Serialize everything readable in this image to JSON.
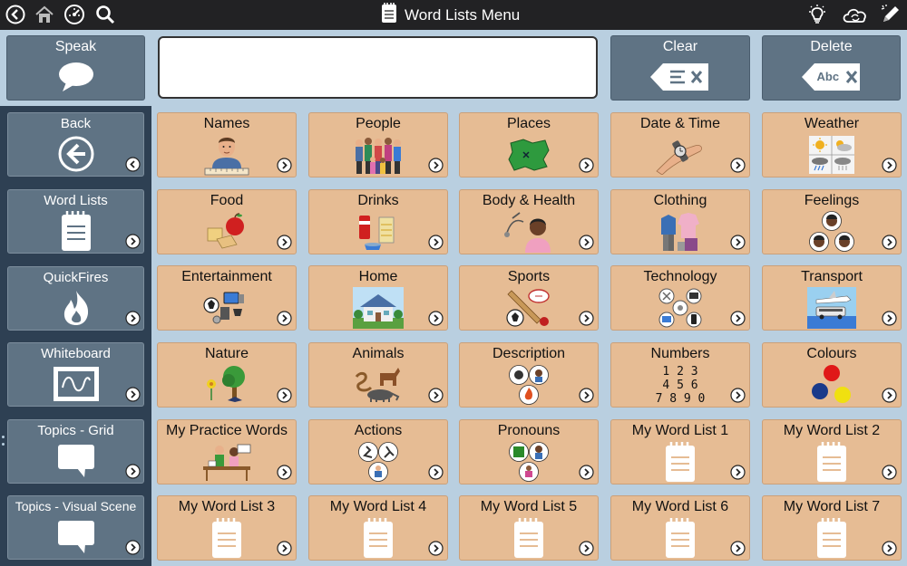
{
  "topbar": {
    "title": "Word Lists Menu",
    "left_icons": [
      "back-circle-icon",
      "home-icon",
      "dashboard-icon",
      "search-icon"
    ],
    "right_icons": [
      "lightbulb-icon",
      "cloud-sync-icon",
      "edit-pencil-icon"
    ]
  },
  "speak_row": {
    "speak_label": "Speak",
    "message_text": "",
    "clear_label": "Clear",
    "delete_label": "Delete",
    "delete_icon_text": "Abc"
  },
  "sidebar": {
    "items": [
      {
        "label": "Back",
        "icon": "back-arrow-icon"
      },
      {
        "label": "Word Lists",
        "icon": "notepad-icon"
      },
      {
        "label": "QuickFires",
        "icon": "flame-icon"
      },
      {
        "label": "Whiteboard",
        "icon": "whiteboard-icon"
      },
      {
        "label": "Topics - Grid",
        "icon": "speech-bubble-icon"
      },
      {
        "label": "Topics - Visual Scene",
        "icon": "speech-bubble-icon"
      }
    ]
  },
  "grid": {
    "tiles": [
      {
        "label": "Names",
        "icon": "person-portrait-icon"
      },
      {
        "label": "People",
        "icon": "people-group-icon"
      },
      {
        "label": "Places",
        "icon": "map-icon"
      },
      {
        "label": "Date & Time",
        "icon": "wristwatch-icon"
      },
      {
        "label": "Weather",
        "icon": "weather-icon"
      },
      {
        "label": "Food",
        "icon": "food-icon"
      },
      {
        "label": "Drinks",
        "icon": "drinks-icon"
      },
      {
        "label": "Body & Health",
        "icon": "doctor-icon"
      },
      {
        "label": "Clothing",
        "icon": "clothes-icon"
      },
      {
        "label": "Feelings",
        "icon": "faces-icon"
      },
      {
        "label": "Entertainment",
        "icon": "entertainment-icon"
      },
      {
        "label": "Home",
        "icon": "house-icon"
      },
      {
        "label": "Sports",
        "icon": "sports-balls-icon"
      },
      {
        "label": "Technology",
        "icon": "devices-icon"
      },
      {
        "label": "Transport",
        "icon": "transport-icon"
      },
      {
        "label": "Nature",
        "icon": "tree-icon"
      },
      {
        "label": "Animals",
        "icon": "animals-icon"
      },
      {
        "label": "Description",
        "icon": "description-icon"
      },
      {
        "label": "Numbers",
        "icon": "numbers-icon",
        "digits": [
          "1 2 3",
          "4 5 6",
          "7 8 9 0"
        ]
      },
      {
        "label": "Colours",
        "icon": "colour-dots-icon"
      },
      {
        "label": "My Practice Words",
        "icon": "practice-desk-icon"
      },
      {
        "label": "Actions",
        "icon": "actions-icon"
      },
      {
        "label": "Pronouns",
        "icon": "pronouns-icon"
      },
      {
        "label": "My Word List 1",
        "icon": "notepad-icon"
      },
      {
        "label": "My Word List 2",
        "icon": "notepad-icon"
      },
      {
        "label": "My Word List 3",
        "icon": "notepad-icon"
      },
      {
        "label": "My Word List 4",
        "icon": "notepad-icon"
      },
      {
        "label": "My Word List 5",
        "icon": "notepad-icon"
      },
      {
        "label": "My Word List 6",
        "icon": "notepad-icon"
      },
      {
        "label": "My Word List 7",
        "icon": "notepad-icon"
      }
    ]
  },
  "colors": {
    "topbar": "#222224",
    "speak_bg": "#b9cfe0",
    "nav_button": "#5f7384",
    "tile": "#e6bc94",
    "sidebar": "#2e4053"
  }
}
